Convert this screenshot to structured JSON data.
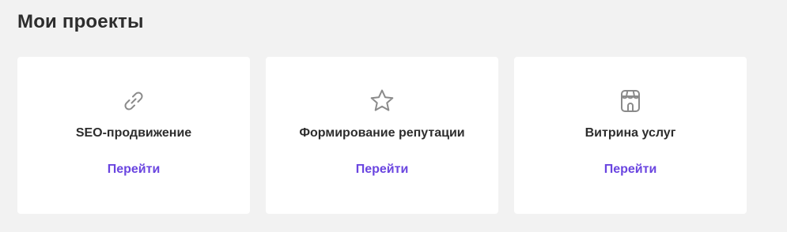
{
  "page": {
    "title": "Мои проекты"
  },
  "projects": [
    {
      "icon": "link-icon",
      "title": "SEO-продвижение",
      "link_label": "Перейти"
    },
    {
      "icon": "star-icon",
      "title": "Формирование репутации",
      "link_label": "Перейти"
    },
    {
      "icon": "storefront-icon",
      "title": "Витрина услуг",
      "link_label": "Перейти"
    }
  ],
  "colors": {
    "background": "#f2f2f2",
    "card": "#ffffff",
    "text": "#2d2d2d",
    "accent": "#6a45e0",
    "icon": "#8a8a8a"
  }
}
